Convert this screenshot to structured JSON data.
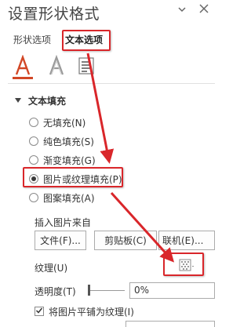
{
  "panel": {
    "title": "设置形状格式",
    "tabs": {
      "shape": "形状选项",
      "text": "文本选项"
    }
  },
  "icons": [
    "text-fill-outline-icon",
    "text-effects-icon",
    "textbox-icon"
  ],
  "section": {
    "label": "文本填充",
    "expanded": true
  },
  "fill_options": [
    {
      "label": "无填充(N)",
      "checked": false
    },
    {
      "label": "纯色填充(S)",
      "checked": false
    },
    {
      "label": "渐变填充(G)",
      "checked": false
    },
    {
      "label": "图片或纹理填充(P)",
      "checked": true
    },
    {
      "label": "图案填充(A)",
      "checked": false
    }
  ],
  "insert": {
    "label": "插入图片来自",
    "buttons": {
      "file": "文件(F)...",
      "clipboard": "剪贴板(C)",
      "online": "联机(E)..."
    }
  },
  "texture": {
    "label": "纹理(U)"
  },
  "transparency": {
    "label": "透明度(T)",
    "value": "0%"
  },
  "tile": {
    "label": "将图片平铺为纹理(I)",
    "checked": true
  },
  "colors": {
    "accent": "#d24726",
    "highlight": "#d9262a"
  }
}
